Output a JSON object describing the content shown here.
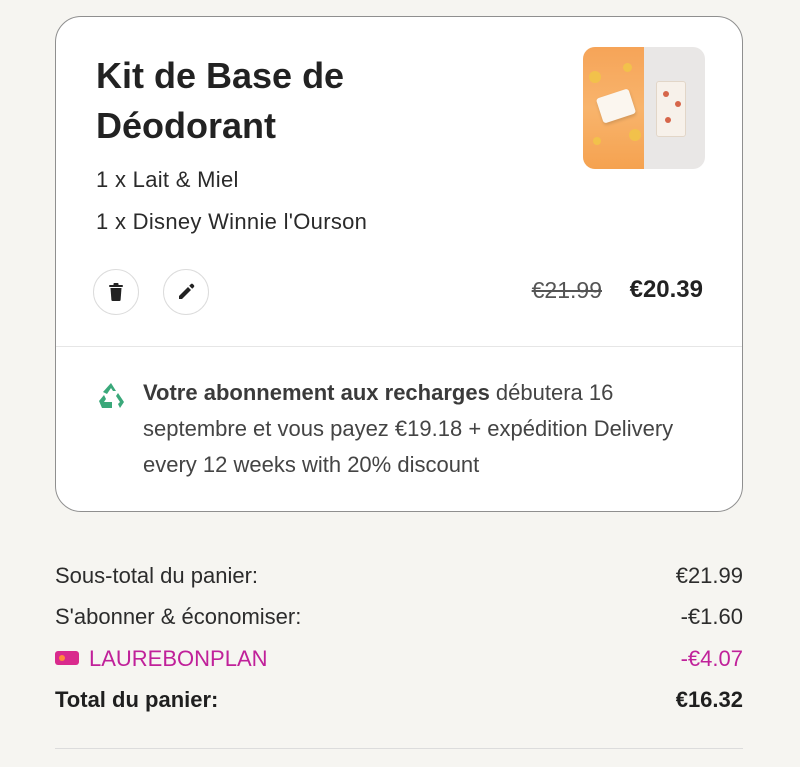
{
  "cart_item": {
    "title": "Kit de Base de Déodorant",
    "variants": [
      "1 x Lait & Miel",
      "1 x Disney Winnie l'Ourson"
    ],
    "price_original": "€21.99",
    "price_current": "€20.39",
    "actions": {
      "delete_icon": "trash-icon",
      "edit_icon": "pencil-icon"
    },
    "subscription": {
      "bold": "Votre abonnement aux recharges",
      "text": " débutera 16 septembre et vous payez €19.18 + expédition Delivery every 12 weeks with 20% discount",
      "icon": "recycle-icon"
    }
  },
  "summary": {
    "subtotal_label": "Sous-total du panier:",
    "subtotal_value": "€21.99",
    "subscribe_label": "S'abonner & économiser:",
    "subscribe_value": "-€1.60",
    "coupon_code": "LAUREBONPLAN",
    "coupon_value": "-€4.07",
    "total_label": "Total du panier:",
    "total_value": "€16.32"
  },
  "colors": {
    "background": "#f6f5f1",
    "coupon": "#c0219a",
    "recycle": "#3aa87a"
  }
}
